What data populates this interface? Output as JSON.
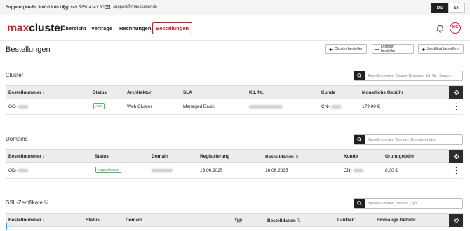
{
  "topbar": {
    "support": "Support (Mo-Fr, 9:00-18:00 Uhr)",
    "phone": "+49 5251 4141 30",
    "email": "support@maxcluster.de",
    "lang_de": "DE",
    "lang_en": "EN"
  },
  "nav": {
    "logo_a": "max",
    "logo_b": "cluster",
    "items": [
      "Übersicht",
      "Verträge",
      "Rechnungen",
      "Bestellungen"
    ],
    "avatar": "MC"
  },
  "page": {
    "title": "Bestellungen",
    "actions": [
      "Cluster bestellen",
      "Domain bestellen",
      "Zertifikat bestellen"
    ]
  },
  "cluster": {
    "title": "Cluster",
    "search_placeholder": "Bestellnummer, Cluster-Nummer, Kd. Nr., Kunde...",
    "columns": [
      "Bestellnummer",
      "Status",
      "Architektur",
      "SLA",
      "Kd. Nr.",
      "Kunde",
      "Monatliche Gebühr"
    ],
    "rows": [
      {
        "order": "OC-",
        "status": "Aktiv",
        "architecture": "Web Cluster",
        "sla": "Managed Basic",
        "customer": "CN-",
        "fee": "179,00 €"
      }
    ]
  },
  "domains": {
    "title": "Domains",
    "search_placeholder": "Bestellnummer, Domain, Domaininhaber",
    "columns": [
      "Bestellnummer",
      "Status",
      "Domain",
      "Registrierung",
      "Bestelldatum",
      "Kunde",
      "Grundgebühr"
    ],
    "rows": [
      {
        "order": "OD-",
        "status": "Abgeschlossen",
        "registration": "16.06.2025",
        "order_date": "16.06.2025",
        "customer": "CN-",
        "fee": "8,00 €"
      }
    ]
  },
  "ssl": {
    "title": "SSL-Zertifikate",
    "search_placeholder": "Bestellnummer, Domain, Typ",
    "columns": [
      "Bestellnummer",
      "Status",
      "Domain",
      "Typ",
      "Bestelldatum",
      "Laufzeit",
      "Einmalige Gebühr"
    ]
  },
  "icons": {
    "phone": "phone-icon",
    "mail": "mail-icon",
    "bell": "bell-icon",
    "search": "search-icon",
    "gear": "gear-icon",
    "plus": "plus-icon",
    "sort": "sort-icon",
    "info": "info-icon",
    "kebab": "kebab-icon"
  },
  "colors": {
    "brand_red": "#c91d2c",
    "dark": "#1f1f1f",
    "status_green": "#2a8a3a"
  }
}
